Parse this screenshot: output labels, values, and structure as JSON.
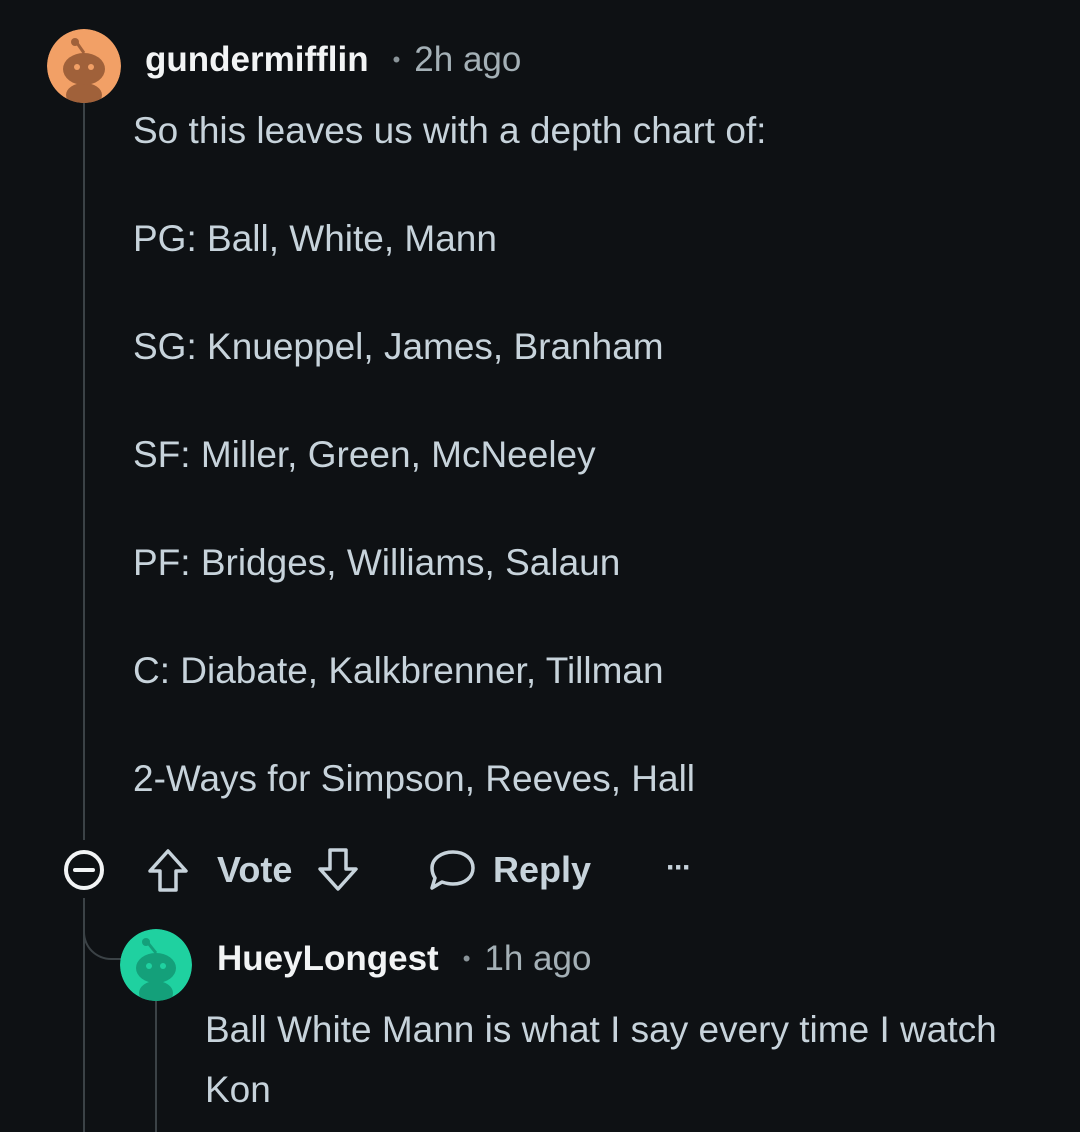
{
  "comment": {
    "username": "gundermifflin",
    "separator": "•",
    "time": "2h ago",
    "paragraphs": [
      "So this leaves us with a depth chart of:",
      "PG: Ball, White, Mann",
      "SG: Knueppel, James, Branham",
      "SF: Miller, Green, McNeeley",
      "PF: Bridges, Williams, Salaun",
      "C: Diabate, Kalkbrenner, Tillman",
      "2-Ways for Simpson, Reeves, Hall"
    ],
    "avatar_color": "#f2a066",
    "actions": {
      "vote_label": "Vote",
      "reply_label": "Reply",
      "more_label": "···",
      "collapse_icon": "collapse-minus-icon",
      "upvote_icon": "upvote-arrow-icon",
      "downvote_icon": "downvote-arrow-icon",
      "reply_icon": "speech-bubble-icon"
    }
  },
  "reply": {
    "username": "HueyLongest",
    "separator": "•",
    "time": "1h ago",
    "body": "Ball White Mann is what I say every time I watch Kon",
    "avatar_color": "#1fd1a0"
  },
  "colors": {
    "background": "#0e1114",
    "text": "#c7d3db",
    "username": "#f2f4f5",
    "thread_line": "#3b4246"
  }
}
